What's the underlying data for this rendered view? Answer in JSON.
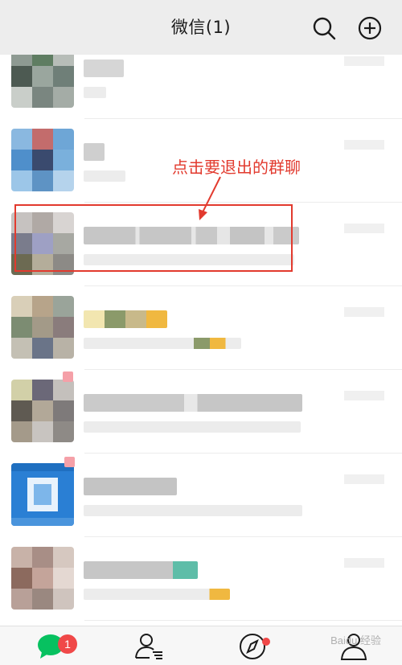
{
  "header": {
    "title": "微信(1)"
  },
  "annotation": {
    "text": "点击要退出的群聊",
    "color": "#e23a2e"
  },
  "tabbar": {
    "chats_badge": "1"
  },
  "watermark": "Baidu 经验",
  "colors": {
    "header_bg": "#ededed",
    "accent_green": "#07c160",
    "badge_red": "#f04848"
  },
  "icons": [
    "search-icon",
    "add-icon",
    "chat-icon",
    "contacts-icon",
    "discover-icon",
    "me-icon"
  ]
}
